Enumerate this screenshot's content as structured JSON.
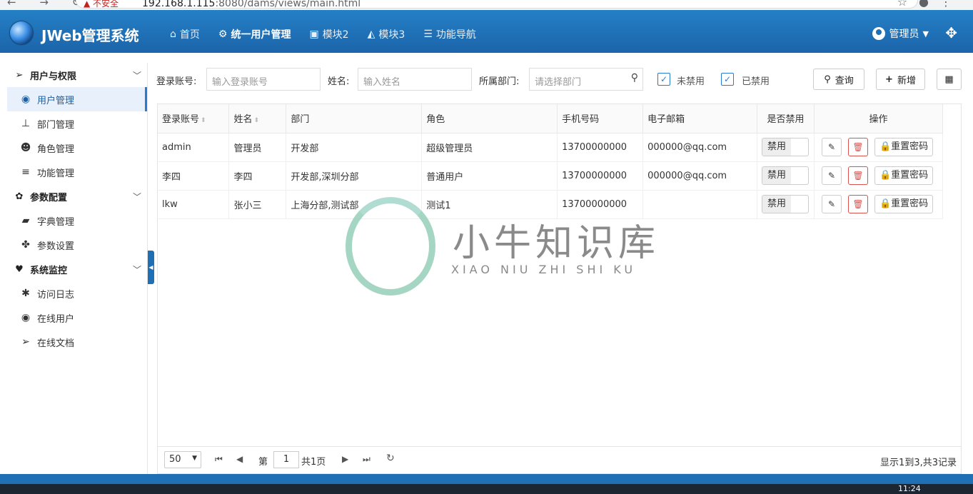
{
  "browser": {
    "security_label": "不安全",
    "url_host": "192.168.1.115",
    "url_rest": ":8080/dams/views/main.html"
  },
  "header": {
    "brand": "JWeb管理系统",
    "nav": [
      {
        "label": "首页",
        "icon": "home-icon"
      },
      {
        "label": "统一用户管理",
        "icon": "gear-icon"
      },
      {
        "label": "模块2",
        "icon": "window-icon"
      },
      {
        "label": "模块3",
        "icon": "chart-icon"
      },
      {
        "label": "功能导航",
        "icon": "list-icon"
      }
    ],
    "user": "管理员"
  },
  "sidebar": {
    "groups": [
      {
        "label": "用户与权限",
        "icon": "paper-plane-icon",
        "items": [
          {
            "label": "用户管理",
            "icon": "user-circle-icon"
          },
          {
            "label": "部门管理",
            "icon": "sitemap-icon"
          },
          {
            "label": "角色管理",
            "icon": "users-icon"
          },
          {
            "label": "功能管理",
            "icon": "bars-icon"
          }
        ]
      },
      {
        "label": "参数配置",
        "icon": "cog-icon",
        "items": [
          {
            "label": "字典管理",
            "icon": "book-icon"
          },
          {
            "label": "参数设置",
            "icon": "puzzle-icon"
          }
        ]
      },
      {
        "label": "系统监控",
        "icon": "heartbeat-icon",
        "items": [
          {
            "label": "访问日志",
            "icon": "bug-icon"
          },
          {
            "label": "在线用户",
            "icon": "user-circle-icon"
          },
          {
            "label": "在线文档",
            "icon": "paper-plane-icon"
          }
        ]
      }
    ]
  },
  "search": {
    "account_label": "登录账号:",
    "account_placeholder": "输入登录账号",
    "name_label": "姓名:",
    "name_placeholder": "输入姓名",
    "dept_label": "所属部门:",
    "dept_placeholder": "请选择部门",
    "not_disabled_label": "未禁用",
    "disabled_label": "已禁用",
    "query_button": "查询",
    "add_button": "新增"
  },
  "table": {
    "columns": [
      "登录账号",
      "姓名",
      "部门",
      "角色",
      "手机号码",
      "电子邮箱",
      "是否禁用",
      "操作"
    ],
    "rows": [
      {
        "account": "admin",
        "name": "管理员",
        "dept": "开发部",
        "role": "超级管理员",
        "phone": "13700000000",
        "email": "000000@qq.com",
        "disabled": "禁用"
      },
      {
        "account": "李四",
        "name": "李四",
        "dept": "开发部,深圳分部",
        "role": "普通用户",
        "phone": "13700000000",
        "email": "000000@qq.com",
        "disabled": "禁用"
      },
      {
        "account": "lkw",
        "name": "张小三",
        "dept": "上海分部,测试部",
        "role": "测试1",
        "phone": "13700000000",
        "email": "",
        "disabled": "禁用"
      }
    ],
    "reset_password": "重置密码"
  },
  "pager": {
    "page_size": "50",
    "page_prefix": "第",
    "page": "1",
    "page_suffix": "共1页",
    "info": "显示1到3,共3记录"
  },
  "watermark": {
    "title": "小牛知识库",
    "subtitle": "XIAO NIU ZHI SHI KU"
  },
  "taskbar": {
    "clock": "11:24"
  }
}
